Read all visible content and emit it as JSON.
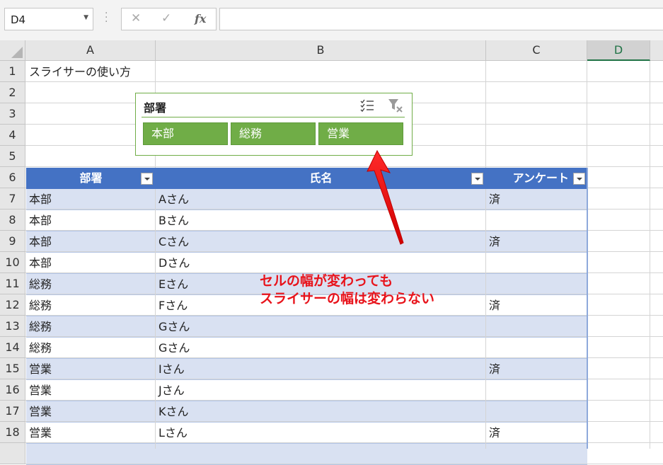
{
  "formula_bar": {
    "name_box": "D4",
    "cancel_glyph": "✕",
    "enter_glyph": "✓",
    "fx_label": "fx",
    "formula": ""
  },
  "columns": [
    "A",
    "B",
    "C",
    "D"
  ],
  "selected_column": "D",
  "rows": [
    "1",
    "2",
    "3",
    "4",
    "5",
    "6",
    "7",
    "8",
    "9",
    "10",
    "11",
    "12",
    "13",
    "14",
    "15",
    "16",
    "17",
    "18"
  ],
  "cells": {
    "A1": "スライサーの使い方"
  },
  "table": {
    "headers": [
      "部署",
      "氏名",
      "アンケート"
    ],
    "rows": [
      [
        "本部",
        "Aさん",
        "済"
      ],
      [
        "本部",
        "Bさん",
        ""
      ],
      [
        "本部",
        "Cさん",
        "済"
      ],
      [
        "本部",
        "Dさん",
        ""
      ],
      [
        "総務",
        "Eさん",
        ""
      ],
      [
        "総務",
        "Fさん",
        "済"
      ],
      [
        "総務",
        "Gさん",
        ""
      ],
      [
        "総務",
        "Gさん",
        ""
      ],
      [
        "営業",
        "Iさん",
        "済"
      ],
      [
        "営業",
        "Jさん",
        ""
      ],
      [
        "営業",
        "Kさん",
        ""
      ],
      [
        "営業",
        "Lさん",
        "済"
      ]
    ],
    "header_color": "#4472c4",
    "band_color": "#d9e1f2"
  },
  "slicer": {
    "title": "部署",
    "items": [
      "本部",
      "総務",
      "営業"
    ],
    "accent": "#70ad47",
    "icons": [
      "multi-select-icon",
      "clear-filter-icon"
    ]
  },
  "annotation": {
    "line1": "セルの幅が変わっても",
    "line2": "スライサーの幅は変わらない",
    "color": "#e8131b"
  }
}
